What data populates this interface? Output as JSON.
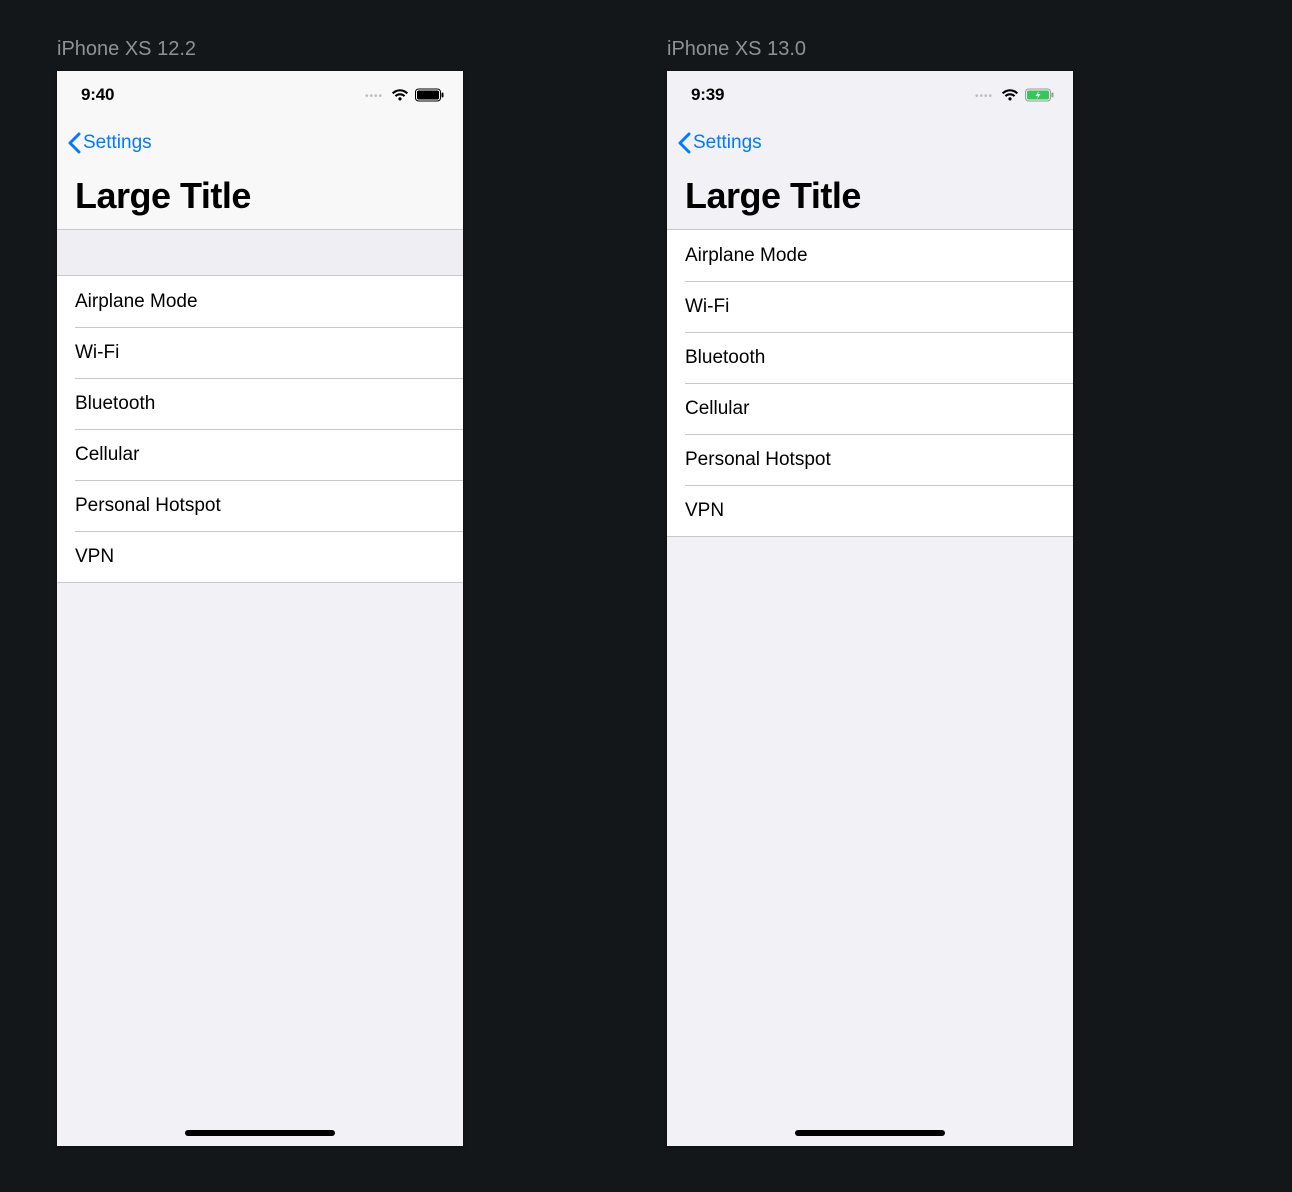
{
  "left": {
    "caption": "iPhone XS 12.2",
    "status_time": "9:40",
    "back_label": "Settings",
    "title": "Large Title",
    "items": [
      "Airplane Mode",
      "Wi-Fi",
      "Bluetooth",
      "Cellular",
      "Personal Hotspot",
      "VPN"
    ],
    "battery_style": "solid-black",
    "tint": "#007aff"
  },
  "right": {
    "caption": "iPhone XS 13.0",
    "status_time": "9:39",
    "back_label": "Settings",
    "title": "Large Title",
    "items": [
      "Airplane Mode",
      "Wi-Fi",
      "Bluetooth",
      "Cellular",
      "Personal Hotspot",
      "VPN"
    ],
    "battery_style": "green-charging",
    "tint": "#007aff"
  }
}
